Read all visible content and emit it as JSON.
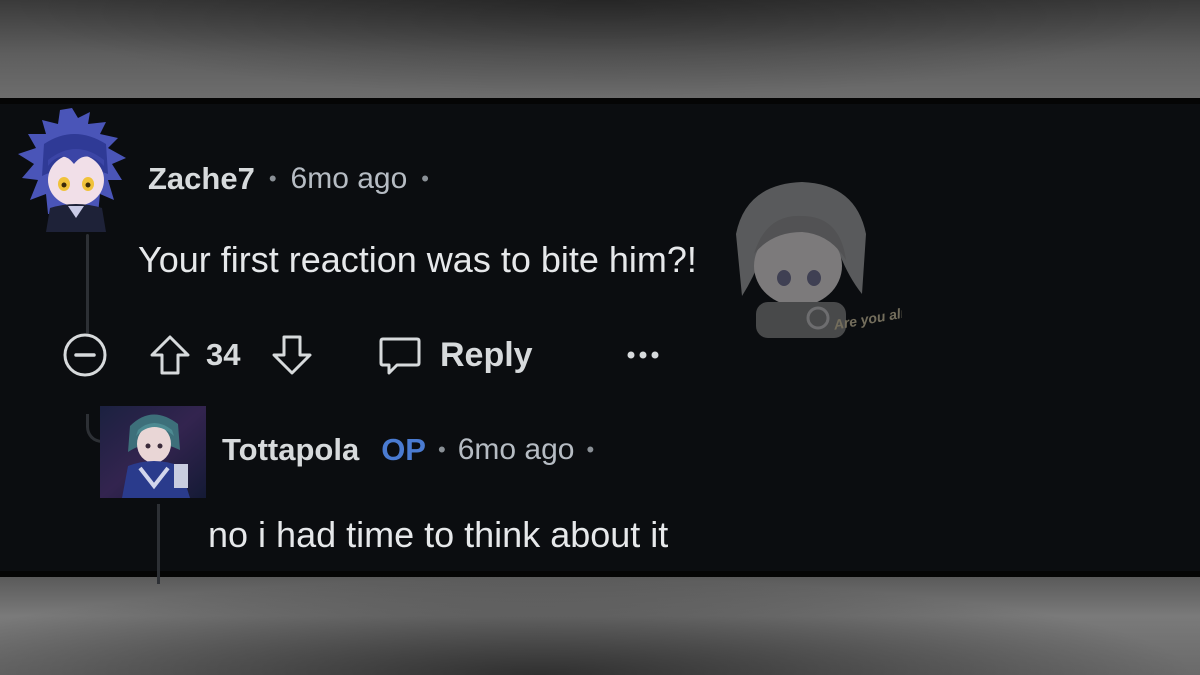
{
  "comments": [
    {
      "username": "Zache7",
      "age": "6mo ago",
      "text": "Your first reaction was to bite him?!",
      "score": "34",
      "reply_label": "Reply"
    },
    {
      "username": "Tottapola",
      "badge": "OP",
      "age": "6mo ago",
      "text": "no i had time to think about it"
    }
  ],
  "separator": "•",
  "sticker": {
    "caption": "Are you alright?"
  },
  "icons": {
    "collapse": "minus-circle-icon",
    "upvote": "arrow-up-icon",
    "downvote": "arrow-down-icon",
    "reply": "speech-bubble-icon",
    "more": "ellipsis-icon"
  },
  "colors": {
    "background": "#0b0d10",
    "text": "#e6e8ea",
    "meta": "#b6bcc3",
    "op_badge": "#4a7bd1",
    "thread_line": "#2d3035"
  }
}
